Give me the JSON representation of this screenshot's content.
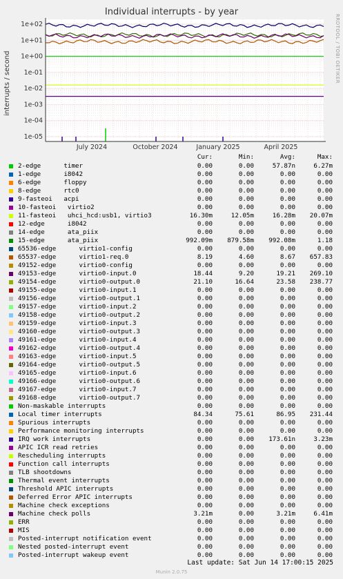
{
  "title": "Individual interrupts - by year",
  "side_label": "RRDTOOL / TOBI OETIKER",
  "ylabel": "interrupts / second",
  "chart_data": {
    "type": "line",
    "yscale": "log",
    "ylim": [
      1e-05,
      100
    ],
    "y_ticks": [
      "1e+02",
      "1e+01",
      "1e+00",
      "1e-01",
      "1e-02",
      "1e-03",
      "1e-04",
      "1e-05"
    ],
    "x_ticks": [
      "July 2024",
      "October 2024",
      "January 2025",
      "April 2025"
    ],
    "grid": true,
    "series": [
      {
        "name": "Local timer interrupts",
        "color": "#000066",
        "level": 84.34
      },
      {
        "name": "15-edge ata_piix",
        "color": "#00cc00",
        "level": 0.99209
      },
      {
        "name": "49154-edge virtio0-output.0",
        "color": "#336600",
        "level": 21.1
      },
      {
        "name": "49153-edge virtio0-input.0",
        "color": "#660066",
        "level": 18.44
      },
      {
        "name": "65537-edge virtio1-req.0",
        "color": "#aa5500",
        "level": 8.19
      },
      {
        "name": "11-fasteoi uhci_hcd:usb1, virtio3",
        "color": "#ccff00",
        "level": 0.0163
      },
      {
        "name": "Machine check polls",
        "color": "#660099",
        "level": 0.00321
      }
    ]
  },
  "legend": {
    "headers": {
      "cur": "Cur:",
      "min": "Min:",
      "avg": "Avg:",
      "max": "Max:"
    },
    "rows": [
      {
        "name": "2-edge      timer",
        "color": "#00cc00",
        "cur": "0.00",
        "min": "0.00",
        "avg": "57.87n",
        "max": "6.27m"
      },
      {
        "name": "1-edge      i8042",
        "color": "#0066b3",
        "cur": "0.00",
        "min": "0.00",
        "avg": "0.00",
        "max": "0.00"
      },
      {
        "name": "6-edge      floppy",
        "color": "#ff8000",
        "cur": "0.00",
        "min": "0.00",
        "avg": "0.00",
        "max": "0.00"
      },
      {
        "name": "8-edge      rtc0",
        "color": "#ffcc00",
        "cur": "0.00",
        "min": "0.00",
        "avg": "0.00",
        "max": "0.00"
      },
      {
        "name": "9-fasteoi   acpi",
        "color": "#330099",
        "cur": "0.00",
        "min": "0.00",
        "avg": "0.00",
        "max": "0.00"
      },
      {
        "name": "10-fasteoi   virtio2",
        "color": "#990099",
        "cur": "0.00",
        "min": "0.00",
        "avg": "0.00",
        "max": "0.00"
      },
      {
        "name": "11-fasteoi   uhci_hcd:usb1, virtio3",
        "color": "#ccff00",
        "cur": "16.30m",
        "min": "12.05m",
        "avg": "16.28m",
        "max": "20.07m"
      },
      {
        "name": "12-edge      i8042",
        "color": "#ff0000",
        "cur": "0.00",
        "min": "0.00",
        "avg": "0.00",
        "max": "0.00"
      },
      {
        "name": "14-edge      ata_piix",
        "color": "#808080",
        "cur": "0.00",
        "min": "0.00",
        "avg": "0.00",
        "max": "0.00"
      },
      {
        "name": "15-edge      ata_piix",
        "color": "#008f00",
        "cur": "992.09m",
        "min": "879.58m",
        "avg": "992.08m",
        "max": "1.18"
      },
      {
        "name": "65536-edge      virtio1-config",
        "color": "#00487d",
        "cur": "0.00",
        "min": "0.00",
        "avg": "0.00",
        "max": "0.00"
      },
      {
        "name": "65537-edge      virtio1-req.0",
        "color": "#b35a00",
        "cur": "8.19",
        "min": "4.60",
        "avg": "8.67",
        "max": "657.83"
      },
      {
        "name": "49152-edge      virtio0-config",
        "color": "#b38f00",
        "cur": "0.00",
        "min": "0.00",
        "avg": "0.00",
        "max": "0.00"
      },
      {
        "name": "49153-edge      virtio0-input.0",
        "color": "#6b006b",
        "cur": "18.44",
        "min": "9.20",
        "avg": "19.21",
        "max": "269.10"
      },
      {
        "name": "49154-edge      virtio0-output.0",
        "color": "#8fb300",
        "cur": "21.10",
        "min": "16.64",
        "avg": "23.58",
        "max": "238.77"
      },
      {
        "name": "49155-edge      virtio0-input.1",
        "color": "#b30000",
        "cur": "0.00",
        "min": "0.00",
        "avg": "0.00",
        "max": "0.00"
      },
      {
        "name": "49156-edge      virtio0-output.1",
        "color": "#bebebe",
        "cur": "0.00",
        "min": "0.00",
        "avg": "0.00",
        "max": "0.00"
      },
      {
        "name": "49157-edge      virtio0-input.2",
        "color": "#80ff80",
        "cur": "0.00",
        "min": "0.00",
        "avg": "0.00",
        "max": "0.00"
      },
      {
        "name": "49158-edge      virtio0-output.2",
        "color": "#80c9ff",
        "cur": "0.00",
        "min": "0.00",
        "avg": "0.00",
        "max": "0.00"
      },
      {
        "name": "49159-edge      virtio0-input.3",
        "color": "#ffc080",
        "cur": "0.00",
        "min": "0.00",
        "avg": "0.00",
        "max": "0.00"
      },
      {
        "name": "49160-edge      virtio0-output.3",
        "color": "#ffe680",
        "cur": "0.00",
        "min": "0.00",
        "avg": "0.00",
        "max": "0.00"
      },
      {
        "name": "49161-edge      virtio0-input.4",
        "color": "#aa80ff",
        "cur": "0.00",
        "min": "0.00",
        "avg": "0.00",
        "max": "0.00"
      },
      {
        "name": "49162-edge      virtio0-output.4",
        "color": "#ee00cc",
        "cur": "0.00",
        "min": "0.00",
        "avg": "0.00",
        "max": "0.00"
      },
      {
        "name": "49163-edge      virtio0-input.5",
        "color": "#ff8080",
        "cur": "0.00",
        "min": "0.00",
        "avg": "0.00",
        "max": "0.00"
      },
      {
        "name": "49164-edge      virtio0-output.5",
        "color": "#666600",
        "cur": "0.00",
        "min": "0.00",
        "avg": "0.00",
        "max": "0.00"
      },
      {
        "name": "49165-edge      virtio0-input.6",
        "color": "#ffbfff",
        "cur": "0.00",
        "min": "0.00",
        "avg": "0.00",
        "max": "0.00"
      },
      {
        "name": "49166-edge      virtio0-output.6",
        "color": "#00ffcc",
        "cur": "0.00",
        "min": "0.00",
        "avg": "0.00",
        "max": "0.00"
      },
      {
        "name": "49167-edge      virtio0-input.7",
        "color": "#cc6699",
        "cur": "0.00",
        "min": "0.00",
        "avg": "0.00",
        "max": "0.00"
      },
      {
        "name": "49168-edge      virtio0-output.7",
        "color": "#999900",
        "cur": "0.00",
        "min": "0.00",
        "avg": "0.00",
        "max": "0.00"
      },
      {
        "name": "Non-maskable interrupts",
        "color": "#00cc00",
        "cur": "0.00",
        "min": "0.00",
        "avg": "0.00",
        "max": "0.00"
      },
      {
        "name": "Local timer interrupts",
        "color": "#0066b3",
        "cur": "84.34",
        "min": "75.61",
        "avg": "86.95",
        "max": "231.44"
      },
      {
        "name": "Spurious interrupts",
        "color": "#ff8000",
        "cur": "0.00",
        "min": "0.00",
        "avg": "0.00",
        "max": "0.00"
      },
      {
        "name": "Performance monitoring interrupts",
        "color": "#ffcc00",
        "cur": "0.00",
        "min": "0.00",
        "avg": "0.00",
        "max": "0.00"
      },
      {
        "name": "IRQ work interrupts",
        "color": "#330099",
        "cur": "0.00",
        "min": "0.00",
        "avg": "173.61n",
        "max": "3.23m"
      },
      {
        "name": "APIC ICR read retries",
        "color": "#990099",
        "cur": "0.00",
        "min": "0.00",
        "avg": "0.00",
        "max": "0.00"
      },
      {
        "name": "Rescheduling interrupts",
        "color": "#ccff00",
        "cur": "0.00",
        "min": "0.00",
        "avg": "0.00",
        "max": "0.00"
      },
      {
        "name": "Function call interrupts",
        "color": "#ff0000",
        "cur": "0.00",
        "min": "0.00",
        "avg": "0.00",
        "max": "0.00"
      },
      {
        "name": "TLB shootdowns",
        "color": "#808080",
        "cur": "0.00",
        "min": "0.00",
        "avg": "0.00",
        "max": "0.00"
      },
      {
        "name": "Thermal event interrupts",
        "color": "#008f00",
        "cur": "0.00",
        "min": "0.00",
        "avg": "0.00",
        "max": "0.00"
      },
      {
        "name": "Threshold APIC interrupts",
        "color": "#00487d",
        "cur": "0.00",
        "min": "0.00",
        "avg": "0.00",
        "max": "0.00"
      },
      {
        "name": "Deferred Error APIC interrupts",
        "color": "#b35a00",
        "cur": "0.00",
        "min": "0.00",
        "avg": "0.00",
        "max": "0.00"
      },
      {
        "name": "Machine check exceptions",
        "color": "#b38f00",
        "cur": "0.00",
        "min": "0.00",
        "avg": "0.00",
        "max": "0.00"
      },
      {
        "name": "Machine check polls",
        "color": "#6b006b",
        "cur": "3.21m",
        "min": "0.00",
        "avg": "3.21m",
        "max": "6.41m"
      },
      {
        "name": "ERR",
        "color": "#8fb300",
        "cur": "0.00",
        "min": "0.00",
        "avg": "0.00",
        "max": "0.00"
      },
      {
        "name": "MIS",
        "color": "#b30000",
        "cur": "0.00",
        "min": "0.00",
        "avg": "0.00",
        "max": "0.00"
      },
      {
        "name": "Posted-interrupt notification event",
        "color": "#bebebe",
        "cur": "0.00",
        "min": "0.00",
        "avg": "0.00",
        "max": "0.00"
      },
      {
        "name": "Nested posted-interrupt event",
        "color": "#80ff80",
        "cur": "0.00",
        "min": "0.00",
        "avg": "0.00",
        "max": "0.00"
      },
      {
        "name": "Posted-interrupt wakeup event",
        "color": "#80c9ff",
        "cur": "0.00",
        "min": "0.00",
        "avg": "0.00",
        "max": "0.00"
      }
    ]
  },
  "footer": "Last update: Sat Jun 14 17:00:15 2025",
  "munin_version": "Munin 2.0.75"
}
